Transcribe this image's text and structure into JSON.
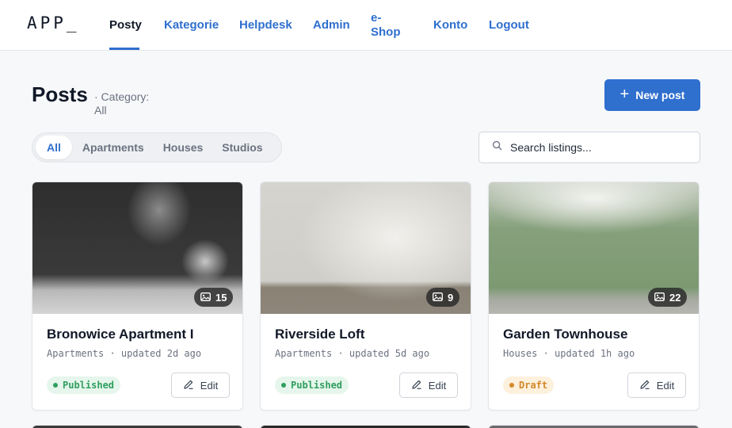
{
  "nav": {
    "logo": "APP_",
    "items": [
      {
        "label": "Posty",
        "active": true
      },
      {
        "label": "Kategorie"
      },
      {
        "label": "Helpdesk"
      },
      {
        "label": "Admin"
      },
      {
        "label": "e-",
        "label2": "Shop"
      },
      {
        "label": "Konto"
      },
      {
        "label": "Logout"
      }
    ]
  },
  "header": {
    "title": "Posts",
    "category_prefix": "· Category:",
    "category_value": "All",
    "new_post_label": "New post",
    "new_post_icon": "plus-icon"
  },
  "filters": {
    "tabs": [
      "All",
      "Apartments",
      "Houses",
      "Studios"
    ],
    "active": "All"
  },
  "search": {
    "placeholder": "Search listings..."
  },
  "cards": [
    {
      "title": "Bronowice Apartment I",
      "meta": "Apartments · updated 2d ago",
      "photo_count": "15",
      "status": "Published",
      "edit_label": "Edit"
    },
    {
      "title": "Riverside Loft",
      "meta": "Apartments · updated 5d ago",
      "photo_count": "9",
      "status": "Published",
      "edit_label": "Edit"
    },
    {
      "title": "Garden Townhouse",
      "meta": "Houses · updated 1h ago",
      "photo_count": "22",
      "status": "Draft",
      "edit_label": "Edit"
    }
  ],
  "colors": {
    "accent": "#2f6fce",
    "published": "#2f9e5e",
    "draft": "#d4882a"
  }
}
